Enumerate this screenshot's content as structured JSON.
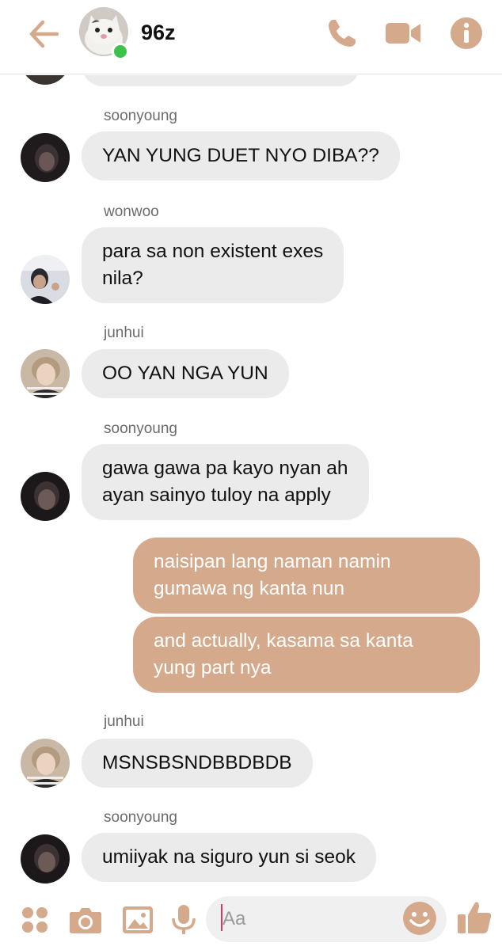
{
  "header": {
    "title": "96z",
    "icons": [
      "back-arrow-icon",
      "phone-icon",
      "video-icon",
      "info-icon"
    ],
    "accent": "#d5a98b"
  },
  "messages": [
    {
      "type": "in",
      "sender": "soonyoung",
      "text": "YAN YUNG DUET NYO DIBA??"
    },
    {
      "type": "in",
      "sender": "wonwoo",
      "text": "para sa non existent exes\nnila?"
    },
    {
      "type": "in",
      "sender": "junhui",
      "text": "OO YAN NGA YUN"
    },
    {
      "type": "in",
      "sender": "soonyoung",
      "text": "gawa gawa pa kayo nyan ah\nayan sainyo tuloy na apply"
    },
    {
      "type": "out",
      "text": "naisipan lang naman namin\ngumawa ng kanta nun"
    },
    {
      "type": "out",
      "text": "and actually, kasama sa kanta\nyung part nya"
    },
    {
      "type": "in",
      "sender": "junhui",
      "text": "MSNSBSNDBBDBDB"
    },
    {
      "type": "in",
      "sender": "soonyoung",
      "text": "umiiyak na siguro yun si seok"
    }
  ],
  "composer": {
    "placeholder": "Aa",
    "icons": [
      "apps-icon",
      "camera-icon",
      "gallery-icon",
      "microphone-icon",
      "emoji-icon",
      "thumbs-up-icon"
    ]
  }
}
